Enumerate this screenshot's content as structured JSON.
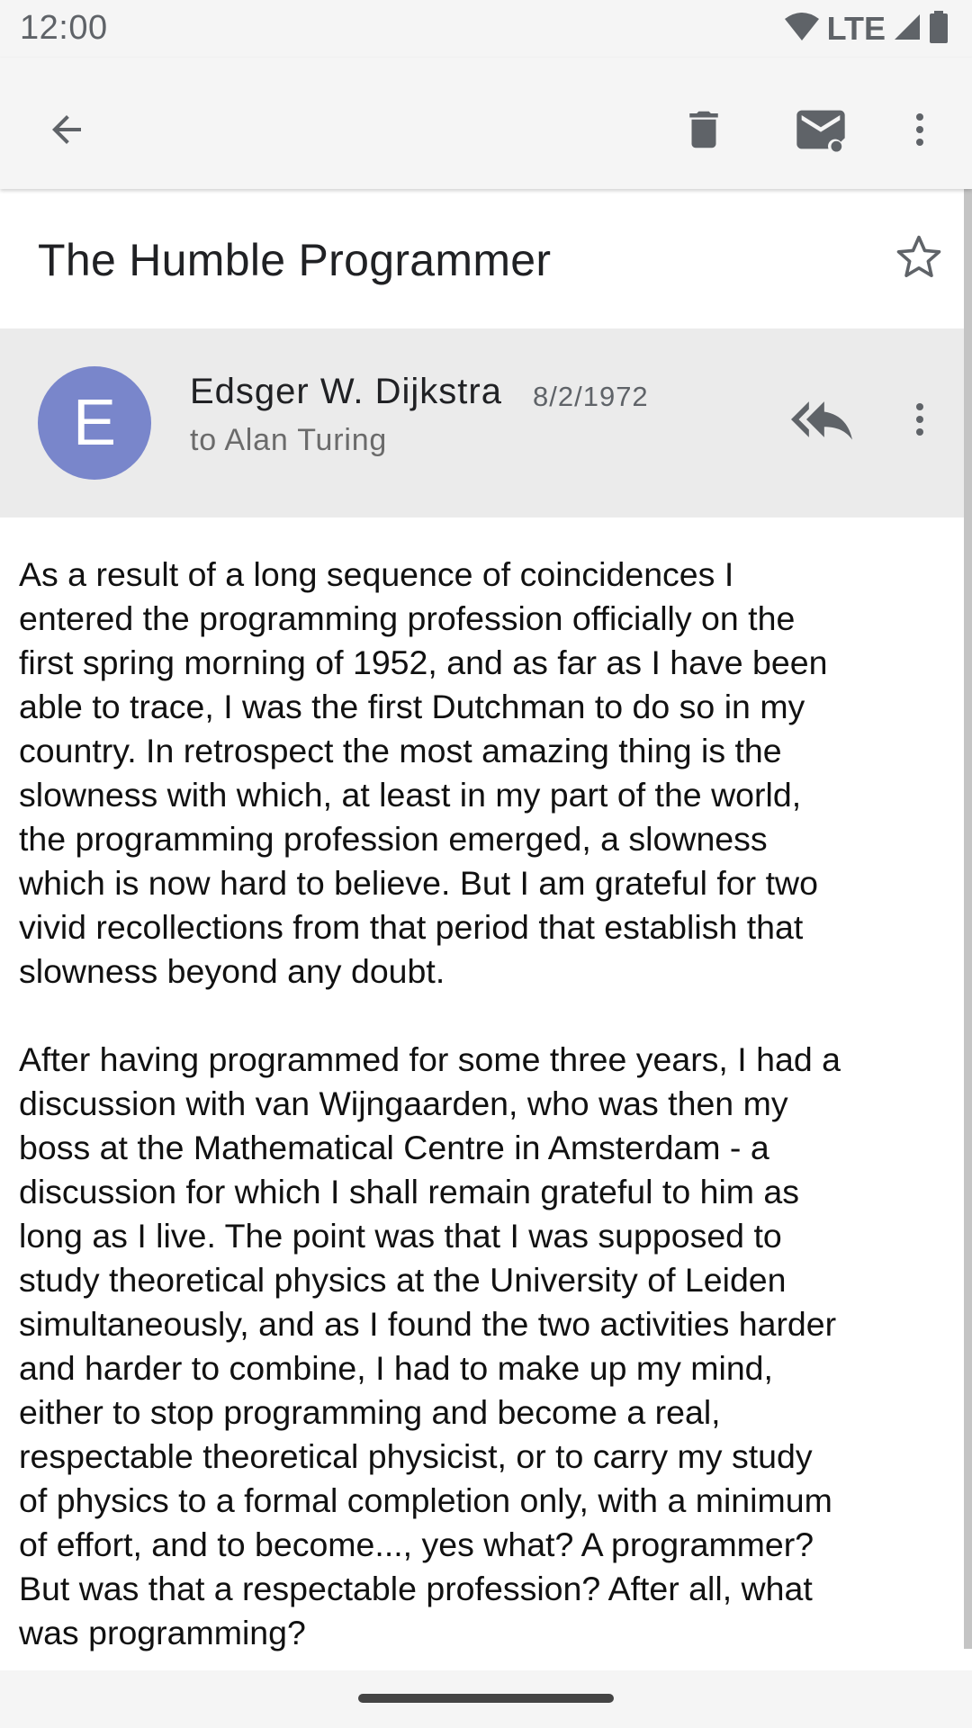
{
  "status_bar": {
    "time": "12:00",
    "network": "LTE",
    "icons": [
      "wifi-icon",
      "cell-signal-icon",
      "battery-icon"
    ]
  },
  "app_bar": {
    "icons": [
      "back-arrow-icon",
      "trash-icon",
      "mark-unread-icon",
      "more-vert-icon"
    ]
  },
  "message": {
    "subject": "The Humble Programmer",
    "starred": false,
    "sender": {
      "initial": "E",
      "name": "Edsger W. Dijkstra",
      "date": "8/2/1972",
      "to": "to Alan Turing",
      "avatar_color": "#7986cb"
    },
    "actions": [
      "reply-all-icon",
      "more-vert-icon"
    ],
    "body": [
      "As a result of a long sequence of coincidences I\nentered the programming profession officially on the\nfirst spring morning of 1952, and as far as I have been\nable to trace, I was the first Dutchman to do so in my\ncountry. In retrospect the most amazing thing is the\nslowness with which, at least in my part of the world,\nthe programming profession emerged, a slowness\nwhich is now hard to believe. But I am grateful for two\nvivid recollections from that period that establish that\nslowness beyond any doubt.",
      "After having programmed for some three years, I had a\ndiscussion with van Wijngaarden, who was then my\nboss at the Mathematical Centre in Amsterdam - a\ndiscussion for which I shall remain grateful to him as\nlong as I live. The point was that I was supposed to\nstudy theoretical physics at the University of Leiden\nsimultaneously, and as I found the two activities harder\nand harder to combine, I had to make up my mind,\neither to stop programming and become a real,\nrespectable theoretical physicist, or to carry my study\nof physics to a formal completion only, with a minimum\nof effort, and to become..., yes what? A programmer?\nBut was that a respectable profession? After all, what\nwas programming?"
    ]
  },
  "colors": {
    "bar_background": "#f5f5f5",
    "sender_background": "#ebebeb",
    "icon_color": "#5f6368"
  }
}
